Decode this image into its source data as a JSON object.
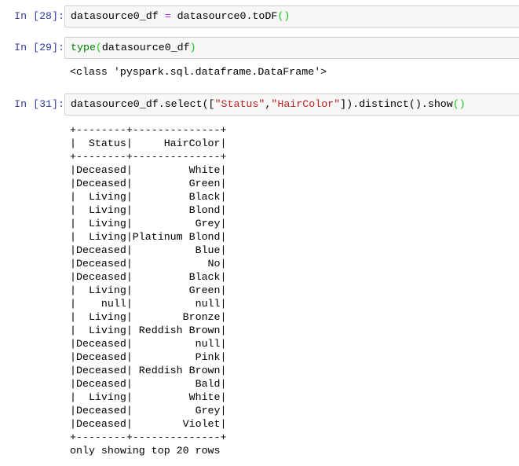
{
  "cells": [
    {
      "prompt": "In [28]:",
      "code": {
        "var": "datasource0_df",
        "op": "=",
        "rhs": "datasource0.toDF",
        "parens": "()"
      }
    },
    {
      "prompt": "In [29]:",
      "code": {
        "fn": "type",
        "open": "(",
        "arg": "datasource0_df",
        "close": ")"
      },
      "output": "<class 'pyspark.sql.dataframe.DataFrame'>"
    },
    {
      "prompt": "In [31]:",
      "code": {
        "pre": "datasource0_df.select([",
        "s1": "\"Status\"",
        "comma": ",",
        "s2": "\"HairColor\"",
        "post": "]).distinct().show",
        "parens": "()"
      },
      "output_table": {
        "border": "+--------+--------------+",
        "headers": [
          "Status",
          "HairColor"
        ],
        "rows": [
          [
            "Deceased",
            "White"
          ],
          [
            "Deceased",
            "Green"
          ],
          [
            "Living",
            "Black"
          ],
          [
            "Living",
            "Blond"
          ],
          [
            "Living",
            "Grey"
          ],
          [
            "Living",
            "Platinum Blond"
          ],
          [
            "Deceased",
            "Blue"
          ],
          [
            "Deceased",
            "No"
          ],
          [
            "Deceased",
            "Black"
          ],
          [
            "Living",
            "Green"
          ],
          [
            "null",
            "null"
          ],
          [
            "Living",
            "Bronze"
          ],
          [
            "Living",
            "Reddish Brown"
          ],
          [
            "Deceased",
            "null"
          ],
          [
            "Deceased",
            "Pink"
          ],
          [
            "Deceased",
            "Reddish Brown"
          ],
          [
            "Deceased",
            "Bald"
          ],
          [
            "Living",
            "White"
          ],
          [
            "Deceased",
            "Grey"
          ],
          [
            "Deceased",
            "Violet"
          ]
        ],
        "footer": "only showing top 20 rows"
      }
    }
  ]
}
